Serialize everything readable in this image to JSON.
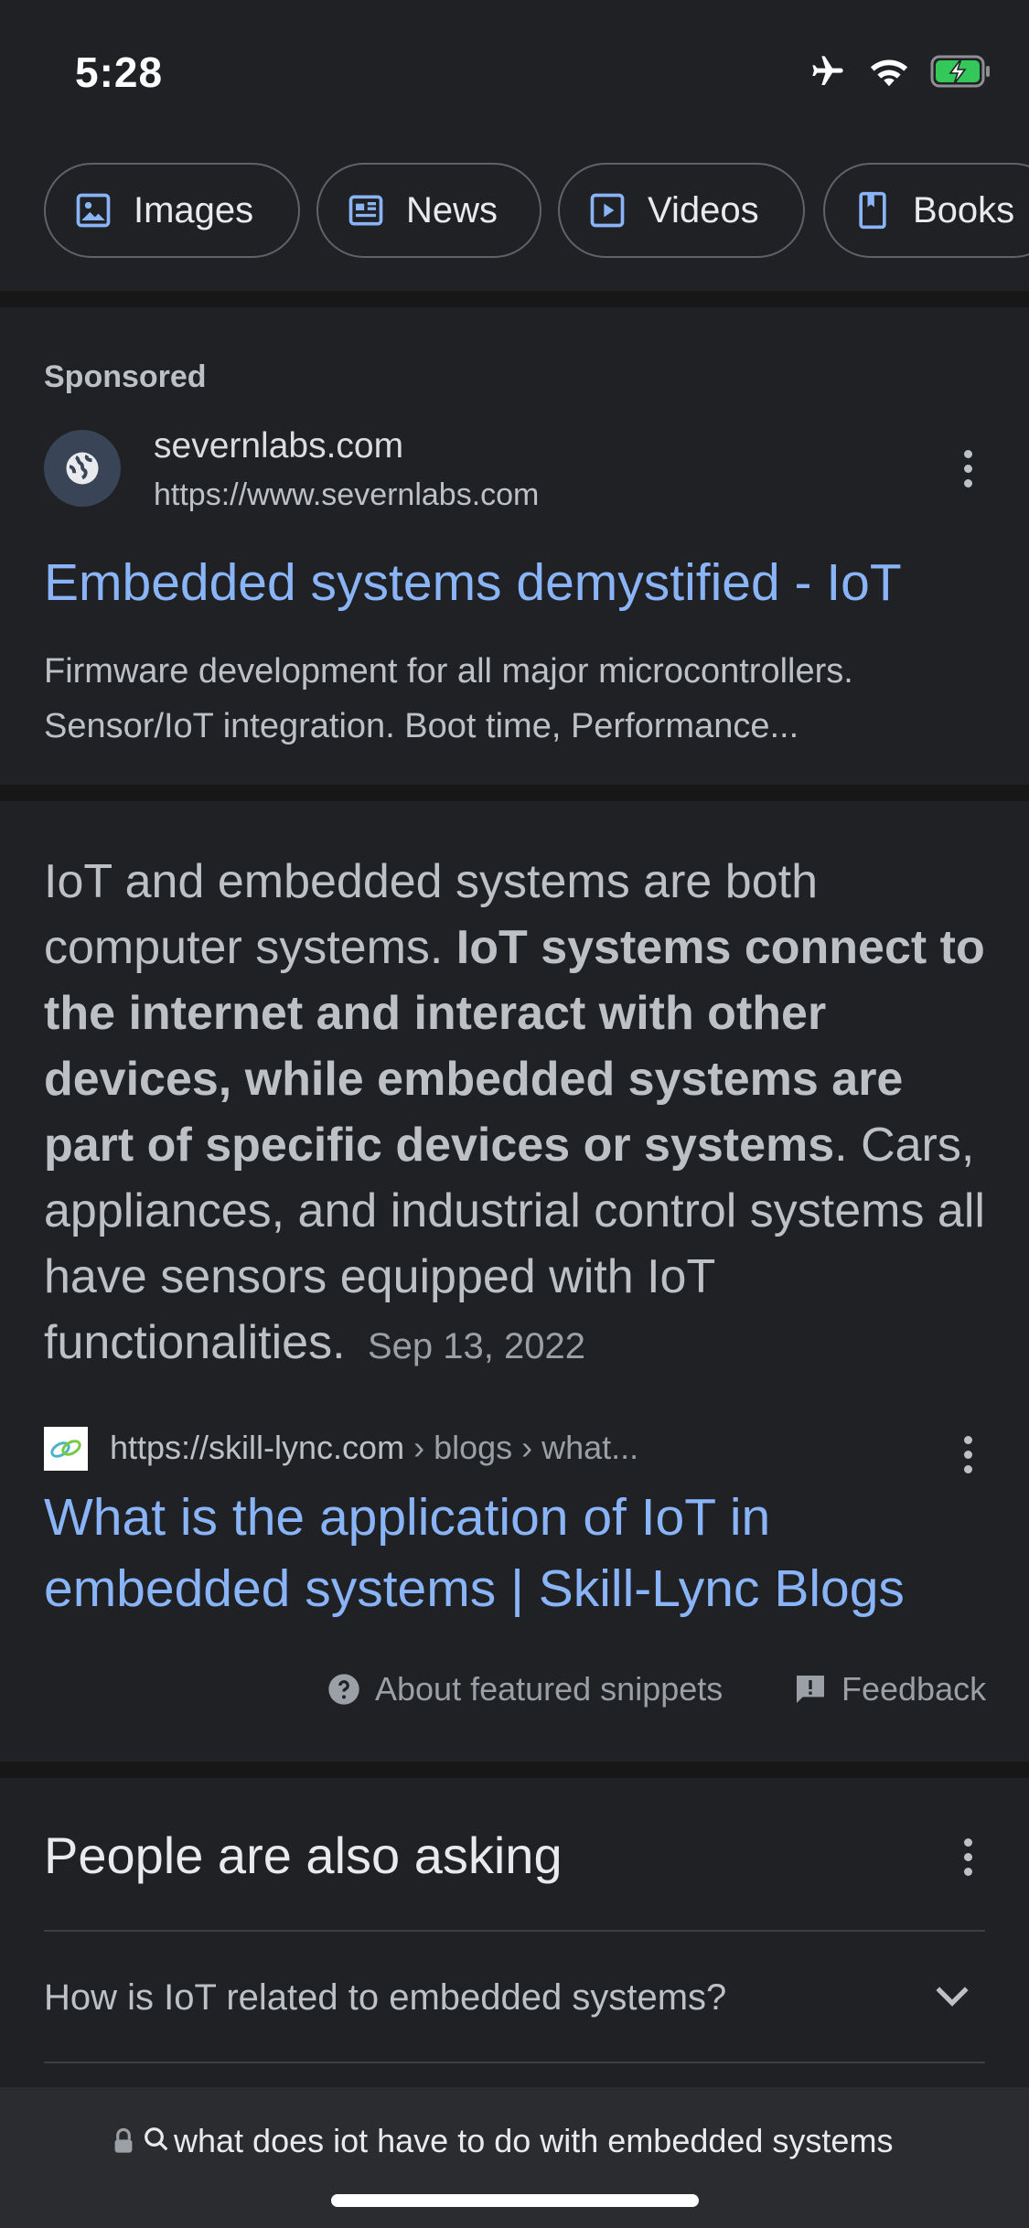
{
  "status_bar": {
    "time": "5:28"
  },
  "chips": [
    {
      "label": "Images",
      "icon": "image-icon"
    },
    {
      "label": "News",
      "icon": "news-icon"
    },
    {
      "label": "Videos",
      "icon": "video-icon"
    },
    {
      "label": "Books",
      "icon": "book-icon"
    }
  ],
  "ad": {
    "sponsored": "Sponsored",
    "domain": "severnlabs.com",
    "url": "https://www.severnlabs.com",
    "title": "Embedded systems demystified - IoT",
    "description": "Firmware development for all major microcontrollers. Sensor/IoT integration. Boot time, Performance..."
  },
  "snippet": {
    "text_before": "IoT and embedded systems are both computer systems. ",
    "bold": "IoT systems connect to the internet and interact with other devices, while embedded systems are part of specific devices or systems",
    "text_after": ". Cars, appliances, and industrial control systems all have sensors equipped with IoT functionalities.",
    "date": "Sep 13, 2022",
    "source_url": "https://skill-lync.com",
    "source_crumbs": " › blogs › what...",
    "source_title": "What is the application of IoT in embedded systems | Skill-Lync Blogs",
    "about": "About featured snippets",
    "feedback": "Feedback"
  },
  "people_also_ask": {
    "title": "People are also asking",
    "questions": [
      "How is IoT related to embedded systems?"
    ]
  },
  "address_bar": {
    "query": "what does iot have to do with embedded systems"
  },
  "colors": {
    "background": "#202124",
    "link": "#8ab4f8",
    "battery": "#34c759"
  }
}
